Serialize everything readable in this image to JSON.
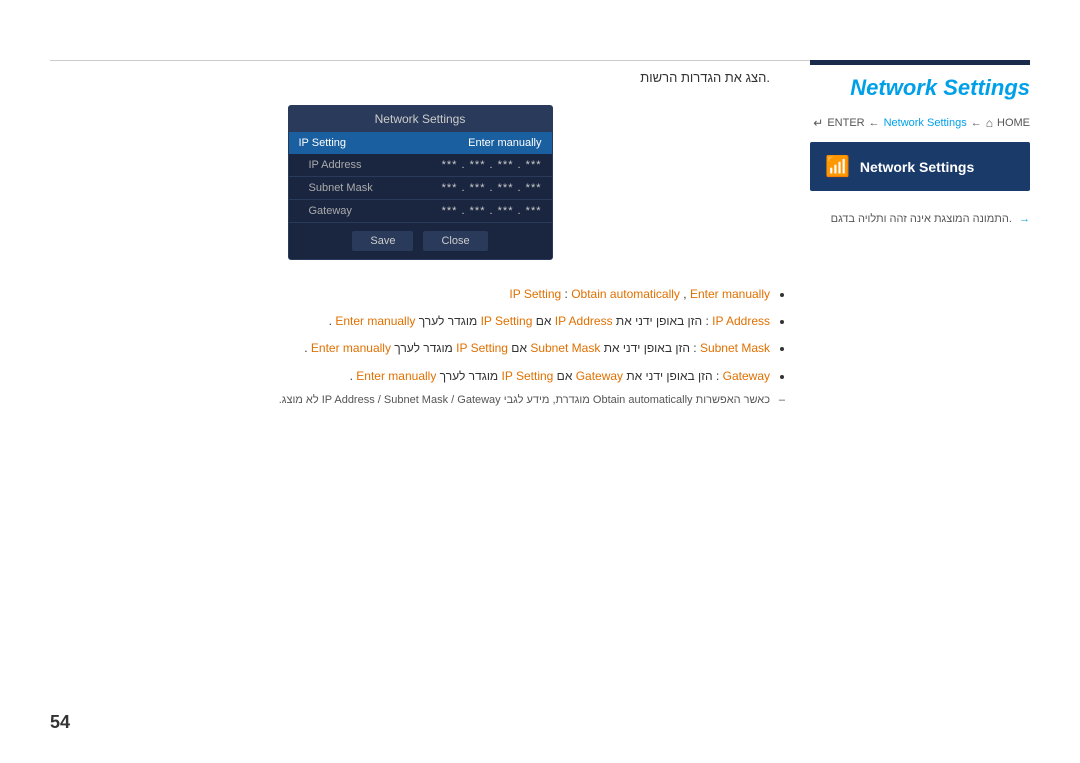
{
  "page": {
    "number": "54"
  },
  "top_divider": true,
  "right_panel": {
    "title": "Network Settings",
    "breadcrumb": {
      "enter": "ENTER",
      "arrow1": "←",
      "link": "Network Settings",
      "arrow2": "←",
      "home_icon": "⌂",
      "home_label": "HOME"
    },
    "button_label": "Network Settings",
    "note_arrow": "→",
    "note_text": ".התמונה המוצגת אינה זהה ותלויה בדגם"
  },
  "dialog": {
    "title": "Network Settings",
    "header_label": "IP Setting",
    "header_value": "Enter manually",
    "rows": [
      {
        "label": "IP Address",
        "value": "***  .  ***  .  ***  .  ***"
      },
      {
        "label": "Subnet Mask",
        "value": "***  .  ***  .  ***  .  ***"
      },
      {
        "label": "Gateway",
        "value": "***  .  ***  .  ***  .  ***"
      }
    ],
    "save_btn": "Save",
    "close_btn": "Close"
  },
  "instruction": ".הצג את הגדרות הרשות",
  "bullets": [
    {
      "text": "IP Setting :Obtain automatically ,Enter manually"
    },
    {
      "text": "IP Address :הזן באופן ידני את IP Address אם IP Setting מוגדר לערך Enter manually."
    },
    {
      "text": "Subnet Mask :הזן באופן ידני את Subnet Mask אם IP Setting מוגדר לערך Enter manually."
    },
    {
      "text": "Gateway :הזן באופן ידני את Gateway אם IP Setting מוגדר לערך Enter manually."
    }
  ],
  "note": "כאשר האפשרות Obtain automatically מוגדרת, מידע לגבי IP Address / Subnet Mask / Gateway לא מוצג.",
  "colors": {
    "orange": "#e07000",
    "blue": "#00a0e9",
    "dark_nav": "#1a2a4a",
    "dialog_bg": "#1a2640"
  }
}
